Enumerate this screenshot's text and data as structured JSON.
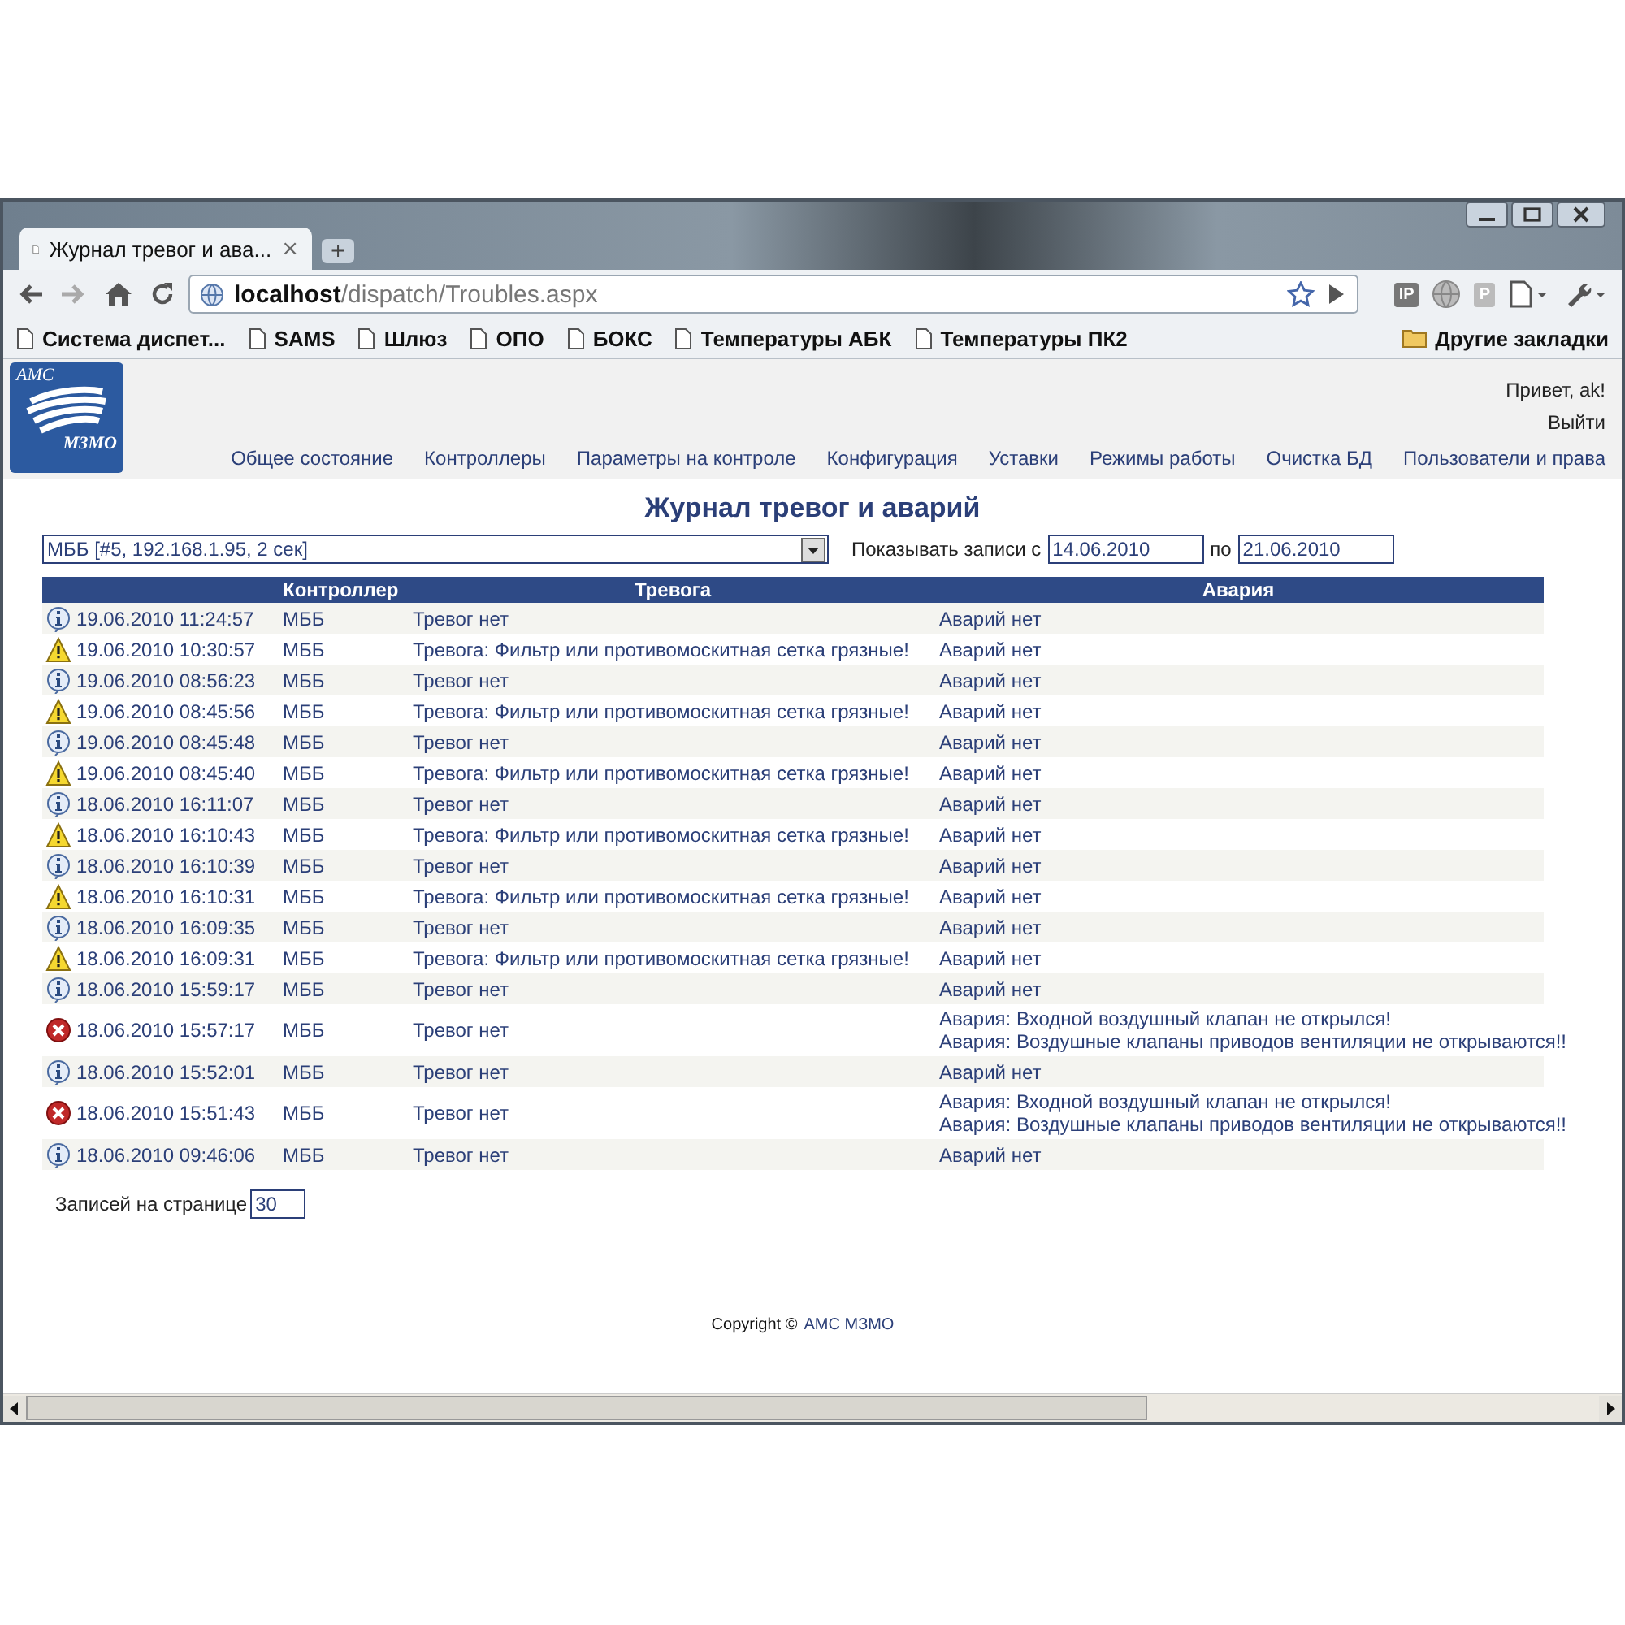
{
  "window": {
    "tab_title": "Журнал тревог и ава...",
    "tab_close": "×",
    "new_tab": "+"
  },
  "toolbar": {
    "url": "**localhost**/dispatch/Troubles.aspx",
    "extension_labels": [
      "IP",
      "P"
    ]
  },
  "bookmarks": [
    "Система диспет...",
    "SAMS",
    "Шлюз",
    "ОПО",
    "БОКС",
    "Температуры АБК",
    "Температуры ПК2"
  ],
  "other_bookmarks": "Другие закладки",
  "logo": {
    "top": "АМС",
    "bottom": "МЗМО"
  },
  "user": {
    "greeting": "Привет, ak!",
    "logout": "Выйти"
  },
  "nav": [
    "Общее состояние",
    "Контроллеры",
    "Параметры на контроле",
    "Конфигурация",
    "Уставки",
    "Режимы работы",
    "Очистка БД",
    "Пользователи и права"
  ],
  "page_title": "Журнал тревог и аварий",
  "filter": {
    "controller": "МББ [#5, 192.168.1.95, 2 сек]",
    "show_label": "Показывать записи с",
    "from": "14.06.2010",
    "to_label": "по",
    "to": "21.06.2010"
  },
  "table": {
    "columns": [
      "",
      "Контроллер",
      "Тревога",
      "Авария"
    ],
    "rows": [
      {
        "kind": "info",
        "time": "19.06.2010 11:24:57",
        "controller": "МББ",
        "alarm": "Тревог нет",
        "crash": [
          "Аварий нет"
        ]
      },
      {
        "kind": "warning",
        "time": "19.06.2010 10:30:57",
        "controller": "МББ",
        "alarm": "Тревога: Фильтр или противомоскитная сетка грязные!",
        "crash": [
          "Аварий нет"
        ]
      },
      {
        "kind": "info",
        "time": "19.06.2010 08:56:23",
        "controller": "МББ",
        "alarm": "Тревог нет",
        "crash": [
          "Аварий нет"
        ]
      },
      {
        "kind": "warning",
        "time": "19.06.2010 08:45:56",
        "controller": "МББ",
        "alarm": "Тревога: Фильтр или противомоскитная сетка грязные!",
        "crash": [
          "Аварий нет"
        ]
      },
      {
        "kind": "info",
        "time": "19.06.2010 08:45:48",
        "controller": "МББ",
        "alarm": "Тревог нет",
        "crash": [
          "Аварий нет"
        ]
      },
      {
        "kind": "warning",
        "time": "19.06.2010 08:45:40",
        "controller": "МББ",
        "alarm": "Тревога: Фильтр или противомоскитная сетка грязные!",
        "crash": [
          "Аварий нет"
        ]
      },
      {
        "kind": "info",
        "time": "18.06.2010 16:11:07",
        "controller": "МББ",
        "alarm": "Тревог нет",
        "crash": [
          "Аварий нет"
        ]
      },
      {
        "kind": "warning",
        "time": "18.06.2010 16:10:43",
        "controller": "МББ",
        "alarm": "Тревога: Фильтр или противомоскитная сетка грязные!",
        "crash": [
          "Аварий нет"
        ]
      },
      {
        "kind": "info",
        "time": "18.06.2010 16:10:39",
        "controller": "МББ",
        "alarm": "Тревог нет",
        "crash": [
          "Аварий нет"
        ]
      },
      {
        "kind": "warning",
        "time": "18.06.2010 16:10:31",
        "controller": "МББ",
        "alarm": "Тревога: Фильтр или противомоскитная сетка грязные!",
        "crash": [
          "Аварий нет"
        ]
      },
      {
        "kind": "info",
        "time": "18.06.2010 16:09:35",
        "controller": "МББ",
        "alarm": "Тревог нет",
        "crash": [
          "Аварий нет"
        ]
      },
      {
        "kind": "warning",
        "time": "18.06.2010 16:09:31",
        "controller": "МББ",
        "alarm": "Тревога: Фильтр или противомоскитная сетка грязные!",
        "crash": [
          "Аварий нет"
        ]
      },
      {
        "kind": "info",
        "time": "18.06.2010 15:59:17",
        "controller": "МББ",
        "alarm": "Тревог нет",
        "crash": [
          "Аварий нет"
        ]
      },
      {
        "kind": "error",
        "time": "18.06.2010 15:57:17",
        "controller": "МББ",
        "alarm": "Тревог нет",
        "crash": [
          "Авария: Входной воздушный клапан не открылся!",
          "Авария: Воздушные клапаны приводов вентиляции не открываются!!"
        ]
      },
      {
        "kind": "info",
        "time": "18.06.2010 15:52:01",
        "controller": "МББ",
        "alarm": "Тревог нет",
        "crash": [
          "Аварий нет"
        ]
      },
      {
        "kind": "error",
        "time": "18.06.2010 15:51:43",
        "controller": "МББ",
        "alarm": "Тревог нет",
        "crash": [
          "Авария: Входной воздушный клапан не открылся!",
          "Авария: Воздушные клапаны приводов вентиляции не открываются!!"
        ]
      },
      {
        "kind": "info",
        "time": "18.06.2010 09:46:06",
        "controller": "МББ",
        "alarm": "Тревог нет",
        "crash": [
          "Аварий нет"
        ]
      }
    ]
  },
  "page_size": {
    "label": "Записей на странице",
    "value": "30"
  },
  "footer": {
    "text": "Copyright ©",
    "link": "АМС МЗМО"
  }
}
